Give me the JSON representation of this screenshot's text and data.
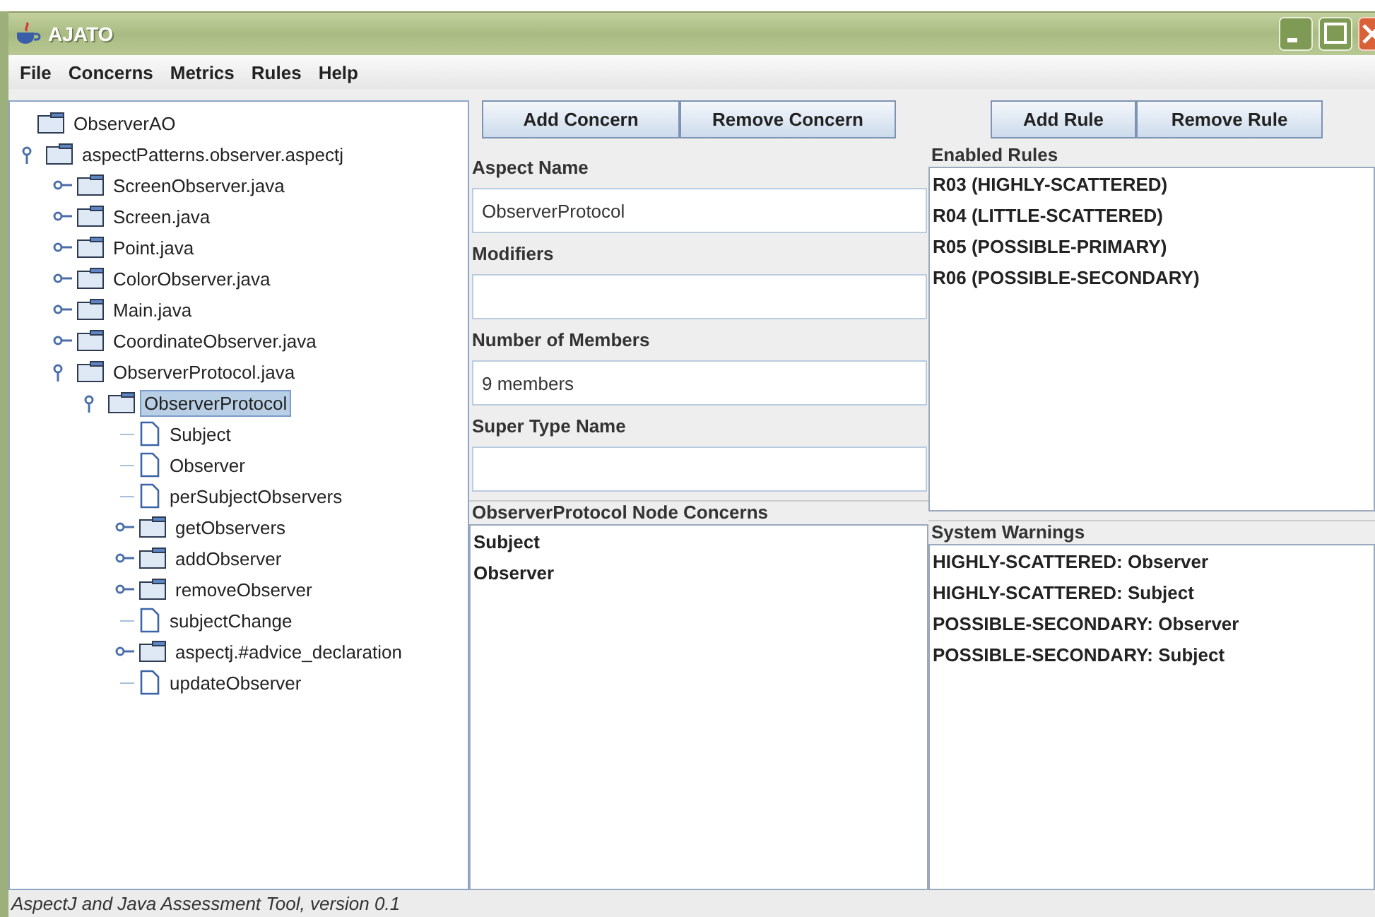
{
  "window": {
    "title": "AJATO"
  },
  "menu": [
    {
      "label": "File"
    },
    {
      "label": "Concerns"
    },
    {
      "label": "Metrics"
    },
    {
      "label": "Rules"
    },
    {
      "label": "Help"
    }
  ],
  "tree": {
    "label": "ObserverAO",
    "kind": "folder",
    "selected": false,
    "children": [
      {
        "label": "aspectPatterns.observer.aspectj",
        "kind": "folder",
        "expanded": true,
        "selected": false,
        "children": [
          {
            "label": "ScreenObserver.java",
            "kind": "folder",
            "expanded": false,
            "selected": false
          },
          {
            "label": "Screen.java",
            "kind": "folder",
            "expanded": false,
            "selected": false
          },
          {
            "label": "Point.java",
            "kind": "folder",
            "expanded": false,
            "selected": false
          },
          {
            "label": "ColorObserver.java",
            "kind": "folder",
            "expanded": false,
            "selected": false
          },
          {
            "label": "Main.java",
            "kind": "folder",
            "expanded": false,
            "selected": false
          },
          {
            "label": "CoordinateObserver.java",
            "kind": "folder",
            "expanded": false,
            "selected": false
          },
          {
            "label": "ObserverProtocol.java",
            "kind": "folder",
            "expanded": true,
            "selected": false,
            "children": [
              {
                "label": "ObserverProtocol",
                "kind": "folder",
                "expanded": true,
                "selected": true,
                "children": [
                  {
                    "label": "Subject",
                    "kind": "file",
                    "selected": false
                  },
                  {
                    "label": "Observer",
                    "kind": "file",
                    "selected": false
                  },
                  {
                    "label": "perSubjectObservers",
                    "kind": "file",
                    "selected": false
                  },
                  {
                    "label": "getObservers",
                    "kind": "folder",
                    "expanded": false,
                    "selected": false
                  },
                  {
                    "label": "addObserver",
                    "kind": "folder",
                    "expanded": false,
                    "selected": false
                  },
                  {
                    "label": "removeObserver",
                    "kind": "folder",
                    "expanded": false,
                    "selected": false
                  },
                  {
                    "label": "subjectChange",
                    "kind": "file",
                    "selected": false
                  },
                  {
                    "label": "aspectj.#advice_declaration",
                    "kind": "folder",
                    "expanded": false,
                    "selected": false
                  },
                  {
                    "label": "updateObserver",
                    "kind": "file",
                    "selected": false
                  }
                ]
              }
            ]
          }
        ]
      }
    ]
  },
  "concern_buttons": [
    "Add Concern",
    "Remove Concern"
  ],
  "fields": [
    {
      "label": "Aspect Name",
      "value": "ObserverProtocol"
    },
    {
      "label": "Modifiers"
    },
    {
      "label": "Number of Members",
      "value": "9 members"
    },
    {
      "label": "Super Type Name"
    }
  ],
  "node_concerns": {
    "title": "ObserverProtocol Node Concerns",
    "items": [
      "Subject",
      "Observer"
    ]
  },
  "rule_buttons": [
    "Add Rule",
    "Remove Rule"
  ],
  "enabled_rules": {
    "title": "Enabled Rules",
    "items": [
      "R03 (HIGHLY-SCATTERED)",
      "R04 (LITTLE-SCATTERED)",
      "R05 (POSSIBLE-PRIMARY)",
      "R06 (POSSIBLE-SECONDARY)"
    ]
  },
  "system_warnings": {
    "title": "System Warnings",
    "items": [
      "HIGHLY-SCATTERED: Observer",
      "HIGHLY-SCATTERED: Subject",
      "POSSIBLE-SECONDARY: Observer",
      "POSSIBLE-SECONDARY: Subject"
    ]
  },
  "status_bar": "AspectJ and Java Assessment Tool, version 0.1"
}
